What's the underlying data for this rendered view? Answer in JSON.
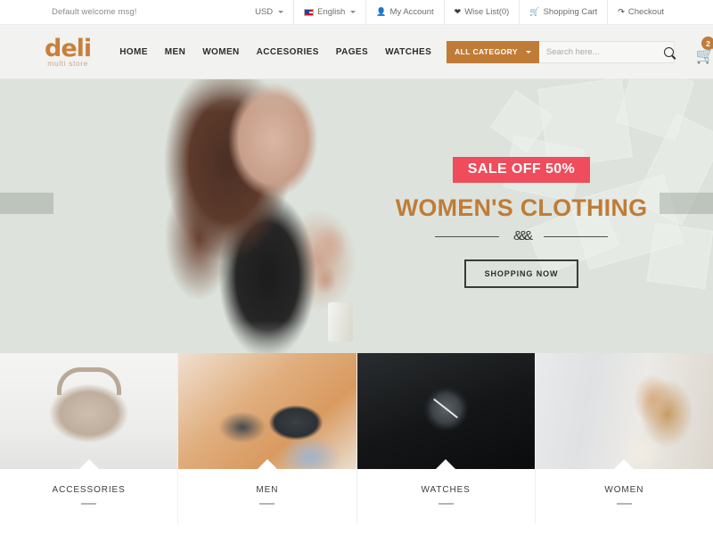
{
  "topbar": {
    "welcome": "Default welcome msg!",
    "currency": "USD",
    "language": "English",
    "account": "My Account",
    "wishlist": "Wise List(0)",
    "cart": "Shopping Cart",
    "checkout": "Checkout"
  },
  "header": {
    "logo_main": "deli",
    "logo_sub": "multi store",
    "nav": [
      {
        "label": "HOME"
      },
      {
        "label": "MEN"
      },
      {
        "label": "WOMEN"
      },
      {
        "label": "ACCESORIES"
      },
      {
        "label": "PAGES"
      },
      {
        "label": "WATCHES"
      }
    ],
    "category_button": "ALL CATEGORY",
    "search_placeholder": "Search here...",
    "search_value": "",
    "cart_count": "2"
  },
  "hero": {
    "sale_badge": "SALE OFF 50%",
    "title": "WOMEN'S CLOTHING",
    "ornament": "&&&",
    "button": "SHOPPING NOW"
  },
  "categories": [
    {
      "label": "ACCESSORIES"
    },
    {
      "label": "MEN"
    },
    {
      "label": "WATCHES"
    },
    {
      "label": "WOMEN"
    }
  ],
  "colors": {
    "brand_orange": "#c07c37",
    "sale_red": "#ef4c5c",
    "hero_bg": "#dde3dc",
    "header_bg": "#f2f2f0"
  }
}
